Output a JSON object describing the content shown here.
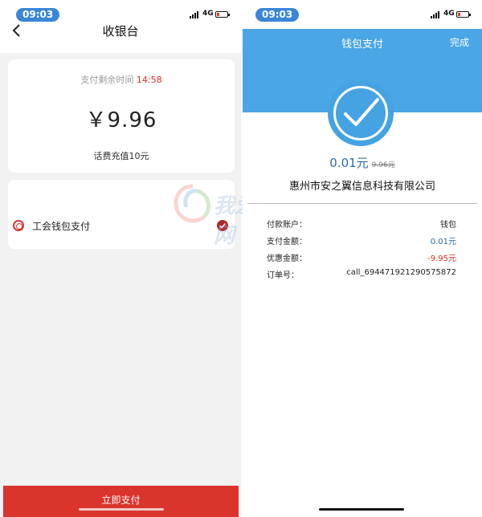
{
  "left": {
    "status": {
      "time": "09:03",
      "network": "4G"
    },
    "header": {
      "title": "收银台"
    },
    "amount_card": {
      "countdown_label": "支付剩余时间",
      "countdown_value": "14:58",
      "amount": "￥9.96",
      "description": "话费充值10元"
    },
    "payment_method": {
      "label": "工会钱包支付",
      "selected": true
    },
    "pay_button": "立即支付"
  },
  "right": {
    "status": {
      "time": "09:03",
      "network": "4G"
    },
    "header": {
      "title": "钱包支付",
      "done": "完成"
    },
    "paid_amount": "0.01元",
    "original_amount": "9.96元",
    "merchant": "惠州市安之翼信息科技有限公司",
    "details": [
      {
        "key": "付款账户：",
        "value": "钱包",
        "style": "plain"
      },
      {
        "key": "支付金额：",
        "value": "0.01元",
        "style": "blue"
      },
      {
        "key": "优惠金额：",
        "value": "-9.95元",
        "style": "red"
      },
      {
        "key": "订单号：",
        "value": "call_694471921290575872",
        "style": "plain"
      }
    ]
  },
  "watermark": "我爱网",
  "colors": {
    "accent_red": "#d9352d",
    "header_blue": "#4aa6e5",
    "text_blue": "#2a6db5",
    "time_pill": "#3a86d8"
  }
}
